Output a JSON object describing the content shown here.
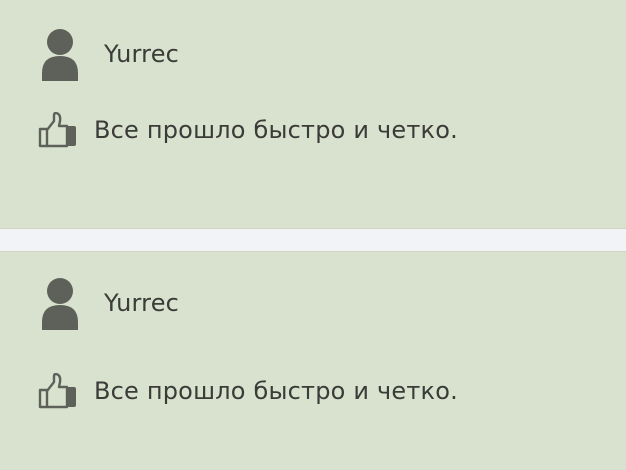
{
  "reviews": [
    {
      "author": "Yurrec",
      "comment": "Все прошло быстро и четко.",
      "avatar_icon": "user-silhouette-icon",
      "rating_icon": "thumbs-up-icon"
    },
    {
      "author": "Yurrec",
      "comment": "Все прошло быстро и четко.",
      "avatar_icon": "user-silhouette-icon",
      "rating_icon": "thumbs-up-icon"
    }
  ],
  "colors": {
    "card_background": "#d8e2cf",
    "separator_background": "#f1f3f6",
    "icon_color": "#5e6159",
    "text_color": "#3b3b38"
  }
}
